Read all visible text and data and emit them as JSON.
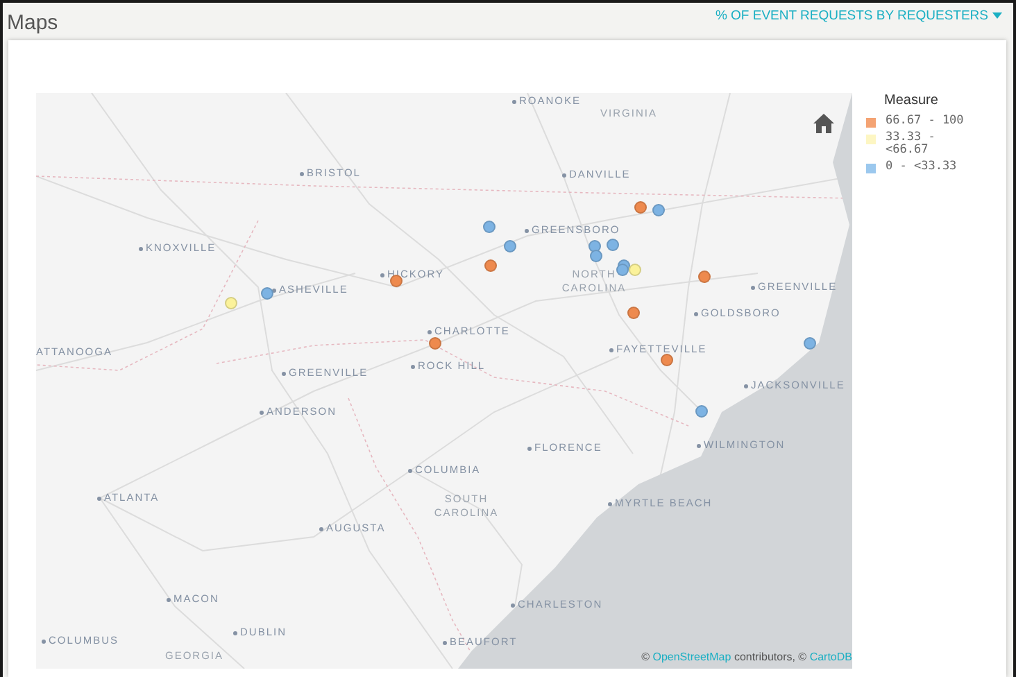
{
  "header": {
    "title": "Maps",
    "dropdown": {
      "label": "% OF EVENT REQUESTS BY REQUESTERS"
    }
  },
  "map": {
    "places": [
      {
        "name": "ROANOKE",
        "kind": "city"
      },
      {
        "name": "VIRGINIA",
        "kind": "region"
      },
      {
        "name": "BRISTOL",
        "kind": "city"
      },
      {
        "name": "DANVILLE",
        "kind": "city"
      },
      {
        "name": "KNOXVILLE",
        "kind": "city"
      },
      {
        "name": "GREENSBORO",
        "kind": "city"
      },
      {
        "name": "HICKORY",
        "kind": "city"
      },
      {
        "name": "ASHEVILLE",
        "kind": "city"
      },
      {
        "name": "NORTH CAROLINA",
        "kind": "region"
      },
      {
        "name": "GREENVILLE",
        "kind": "city"
      },
      {
        "name": "GOLDSBORO",
        "kind": "city"
      },
      {
        "name": "CHARLOTTE",
        "kind": "city"
      },
      {
        "name": "ATTANOOGA",
        "kind": "edge"
      },
      {
        "name": "FAYETTEVILLE",
        "kind": "city"
      },
      {
        "name": "GREENVILLE",
        "kind": "city"
      },
      {
        "name": "ROCK HILL",
        "kind": "city"
      },
      {
        "name": "JACKSONVILLE",
        "kind": "city"
      },
      {
        "name": "ANDERSON",
        "kind": "city"
      },
      {
        "name": "FLORENCE",
        "kind": "city"
      },
      {
        "name": "WILMINGTON",
        "kind": "city"
      },
      {
        "name": "COLUMBIA",
        "kind": "city"
      },
      {
        "name": "ATLANTA",
        "kind": "city"
      },
      {
        "name": "SOUTH CAROLINA",
        "kind": "region"
      },
      {
        "name": "MYRTLE BEACH",
        "kind": "city"
      },
      {
        "name": "AUGUSTA",
        "kind": "city"
      },
      {
        "name": "MACON",
        "kind": "city"
      },
      {
        "name": "CHARLESTON",
        "kind": "city"
      },
      {
        "name": "DUBLIN",
        "kind": "city"
      },
      {
        "name": "COLUMBUS",
        "kind": "city"
      },
      {
        "name": "BEAUFORT",
        "kind": "city"
      },
      {
        "name": "GEORGIA",
        "kind": "region"
      }
    ],
    "points": [
      {
        "color": "#ee8a4e"
      },
      {
        "color": "#ee8a4e"
      },
      {
        "color": "#ee8a4e"
      },
      {
        "color": "#ee8a4e"
      },
      {
        "color": "#ee8a4e"
      },
      {
        "color": "#ee8a4e"
      },
      {
        "color": "#ee8a4e"
      },
      {
        "color": "#7db3e3"
      },
      {
        "color": "#7db3e3"
      },
      {
        "color": "#7db3e3"
      },
      {
        "color": "#7db3e3"
      },
      {
        "color": "#7db3e3"
      },
      {
        "color": "#7db3e3"
      },
      {
        "color": "#7db3e3"
      },
      {
        "color": "#7db3e3"
      },
      {
        "color": "#7db3e3"
      },
      {
        "color": "#7db3e3"
      },
      {
        "color": "#7db3e3"
      },
      {
        "color": "#fbf29a"
      },
      {
        "color": "#fbf29a"
      }
    ],
    "attribution": [
      {
        "kind": "text",
        "text": "©"
      },
      {
        "kind": "link",
        "text": "OpenStreetMap"
      },
      {
        "kind": "text",
        "text": "contributors, ©"
      },
      {
        "kind": "link",
        "text": "CartoDB"
      }
    ]
  },
  "legend": {
    "title": "Measure",
    "items": [
      {
        "label": "66.67 - 100",
        "color": "#f4a373"
      },
      {
        "label": "33.33 - <66.67",
        "color": "#fdf6c3"
      },
      {
        "label": "0 - <33.33",
        "color": "#9bc8ee"
      }
    ]
  }
}
